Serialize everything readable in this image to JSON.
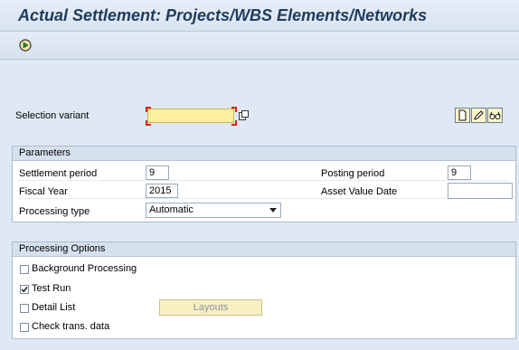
{
  "header": {
    "title": "Actual Settlement: Projects/WBS Elements/Networks"
  },
  "toolbar": {
    "execute_icon": "execute-icon"
  },
  "selection": {
    "label": "Selection variant",
    "value": ""
  },
  "parameters": {
    "title": "Parameters",
    "settlement_period_label": "Settlement period",
    "settlement_period_value": "9",
    "fiscal_year_label": "Fiscal Year",
    "fiscal_year_value": "2015",
    "processing_type_label": "Processing type",
    "processing_type_value": "Automatic",
    "posting_period_label": "Posting period",
    "posting_period_value": "9",
    "asset_value_date_label": "Asset Value Date",
    "asset_value_date_value": ""
  },
  "options": {
    "title": "Processing Options",
    "background_label": "Background Processing",
    "background_checked": false,
    "test_run_label": "Test Run",
    "test_run_checked": true,
    "detail_list_label": "Detail List",
    "detail_list_checked": false,
    "check_trans_label": "Check trans. data",
    "check_trans_checked": false,
    "layouts_label": "Layouts"
  },
  "colors": {
    "accent": "#1f3b5c",
    "background": "#dfe9f5",
    "input_required": "#fbf0a0"
  }
}
